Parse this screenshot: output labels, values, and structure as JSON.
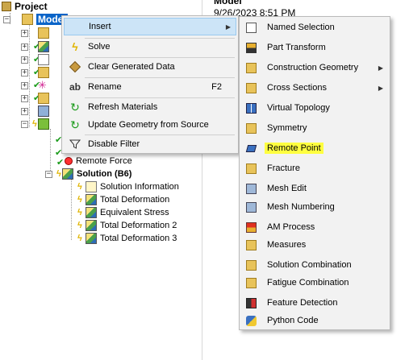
{
  "tree": {
    "project_label": "Project",
    "model_label": "Model",
    "remote_force_label": "Remote Force",
    "solution_label": "Solution (B6)",
    "solution_children": [
      "Solution Information",
      "Total Deformation",
      "Equivalent Stress",
      "Total Deformation 2",
      "Total Deformation 3"
    ]
  },
  "right_panel": {
    "title": "Model",
    "date": "9/26/2023 8:51 PM"
  },
  "context_menu": {
    "items": [
      {
        "label": "Insert",
        "icon": "insert-icon",
        "submenu": true
      },
      {
        "label": "Solve",
        "icon": "solve-lightning-icon"
      },
      {
        "label": "Clear Generated Data",
        "icon": "eraser-icon"
      },
      {
        "label": "Rename",
        "icon": "rename-icon",
        "shortcut": "F2"
      },
      {
        "label": "Refresh Materials",
        "icon": "refresh-icon"
      },
      {
        "label": "Update Geometry from Source",
        "icon": "update-icon"
      },
      {
        "label": "Disable Filter",
        "icon": "filter-icon"
      }
    ]
  },
  "insert_submenu": {
    "items": [
      {
        "label": "Named Selection",
        "icon": "named-selection-icon"
      },
      {
        "label": "Part Transform",
        "icon": "part-transform-icon"
      },
      {
        "label": "Construction Geometry",
        "icon": "construction-geometry-icon",
        "submenu": true
      },
      {
        "label": "Cross Sections",
        "icon": "cross-sections-icon",
        "submenu": true
      },
      {
        "label": "Virtual Topology",
        "icon": "virtual-topology-icon"
      },
      {
        "label": "Symmetry",
        "icon": "symmetry-icon"
      },
      {
        "label": "Remote Point",
        "icon": "remote-point-icon",
        "highlighted": true
      },
      {
        "label": "Fracture",
        "icon": "fracture-icon"
      },
      {
        "label": "Mesh Edit",
        "icon": "mesh-edit-icon"
      },
      {
        "label": "Mesh Numbering",
        "icon": "mesh-numbering-icon"
      },
      {
        "label": "AM Process",
        "icon": "am-process-icon"
      },
      {
        "label": "Measures",
        "icon": "measures-icon"
      },
      {
        "label": "Solution Combination",
        "icon": "solution-combination-icon"
      },
      {
        "label": "Fatigue Combination",
        "icon": "fatigue-combination-icon"
      },
      {
        "label": "Feature Detection",
        "icon": "feature-detection-icon"
      },
      {
        "label": "Python Code",
        "icon": "python-code-icon"
      }
    ]
  },
  "colors": {
    "selection": "#0a64c8",
    "menu_bg": "#f2f2f2",
    "menu_hover": "#cce4f7",
    "highlight": "#ffff40",
    "check_green": "#1a9b1a",
    "bolt_yellow": "#e0b400"
  }
}
